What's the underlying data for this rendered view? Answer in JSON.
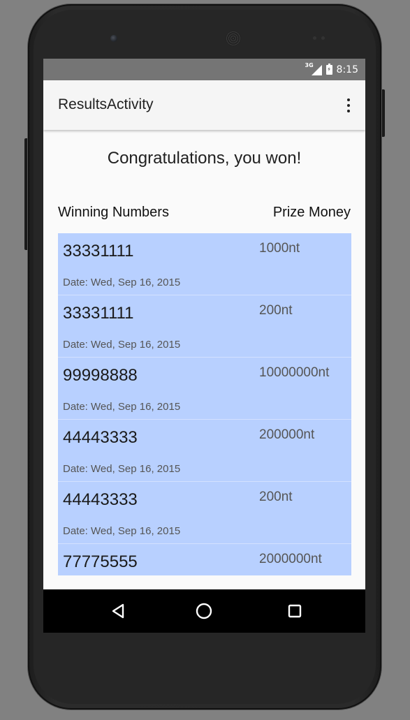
{
  "status_bar": {
    "network": "3G",
    "time": "8:15"
  },
  "app_bar": {
    "title": "ResultsActivity",
    "overflow_icon": "more-vert-icon"
  },
  "content": {
    "message": "Congratulations, you won!",
    "columns": {
      "numbers": "Winning Numbers",
      "prize": "Prize Money"
    },
    "results": [
      {
        "number": "33331111",
        "prize": "1000nt",
        "date": "Date: Wed, Sep 16, 2015"
      },
      {
        "number": "33331111",
        "prize": "200nt",
        "date": "Date: Wed, Sep 16, 2015"
      },
      {
        "number": "99998888",
        "prize": "10000000nt",
        "date": "Date: Wed, Sep 16, 2015"
      },
      {
        "number": "44443333",
        "prize": "200000nt",
        "date": "Date: Wed, Sep 16, 2015"
      },
      {
        "number": "44443333",
        "prize": "200nt",
        "date": "Date: Wed, Sep 16, 2015"
      },
      {
        "number": "77775555",
        "prize": "2000000nt",
        "date": ""
      }
    ]
  },
  "nav_bar": {
    "back_icon": "back-triangle-icon",
    "home_icon": "home-circle-icon",
    "recents_icon": "recents-square-icon"
  },
  "colors": {
    "status_bar": "#757575",
    "app_bar": "#f5f5f5",
    "result_row": "#b8d0ff",
    "nav_bar": "#000000",
    "background": "#818181"
  }
}
